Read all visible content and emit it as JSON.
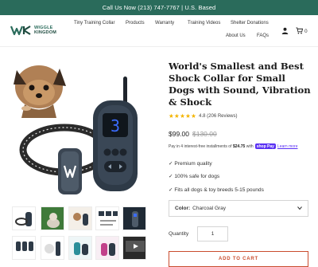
{
  "announcement": "Call Us Now (213) 747-7767 | U.S. Based",
  "brand": {
    "name_line1": "WIGGLE",
    "name_line2": "KINGDOM"
  },
  "nav": {
    "items": [
      "Tiny Training Collar",
      "Products",
      "Warranty",
      "Training Videos",
      "Shelter Donations",
      "About Us",
      "FAQs"
    ]
  },
  "header_icons": {
    "account": "user-icon",
    "cart": "cart-icon",
    "cart_count": "0"
  },
  "product": {
    "title": "World's Smallest and Best Shock Collar for Small Dogs with Sound, Vibration & Shock",
    "rating": 4.8,
    "rating_text": "4.8 (206 Reviews)",
    "price": "$99.00",
    "compare_price": "$130.00",
    "installments": {
      "text_before": "Pay in 4 interest-free installments of",
      "amount": "$24.75",
      "text_with": "with",
      "provider": "shop Pay",
      "learn_more": "Learn more"
    },
    "bullets": [
      "✓ Premium quality",
      "✓ 100% safe for dogs",
      "✓ Fits all dogs & toy breeds 5-15 pounds"
    ],
    "color_label": "Color:",
    "color_value": "Charcoal Gray",
    "quantity_label": "Quantity",
    "quantity_value": "1",
    "add_to_cart": "ADD TO CART"
  },
  "remote_display": "3",
  "colors": {
    "accent": "#2a6b5b",
    "cta": "#c94c2e",
    "star": "#f4b400",
    "shoppay": "#5a31f4"
  }
}
